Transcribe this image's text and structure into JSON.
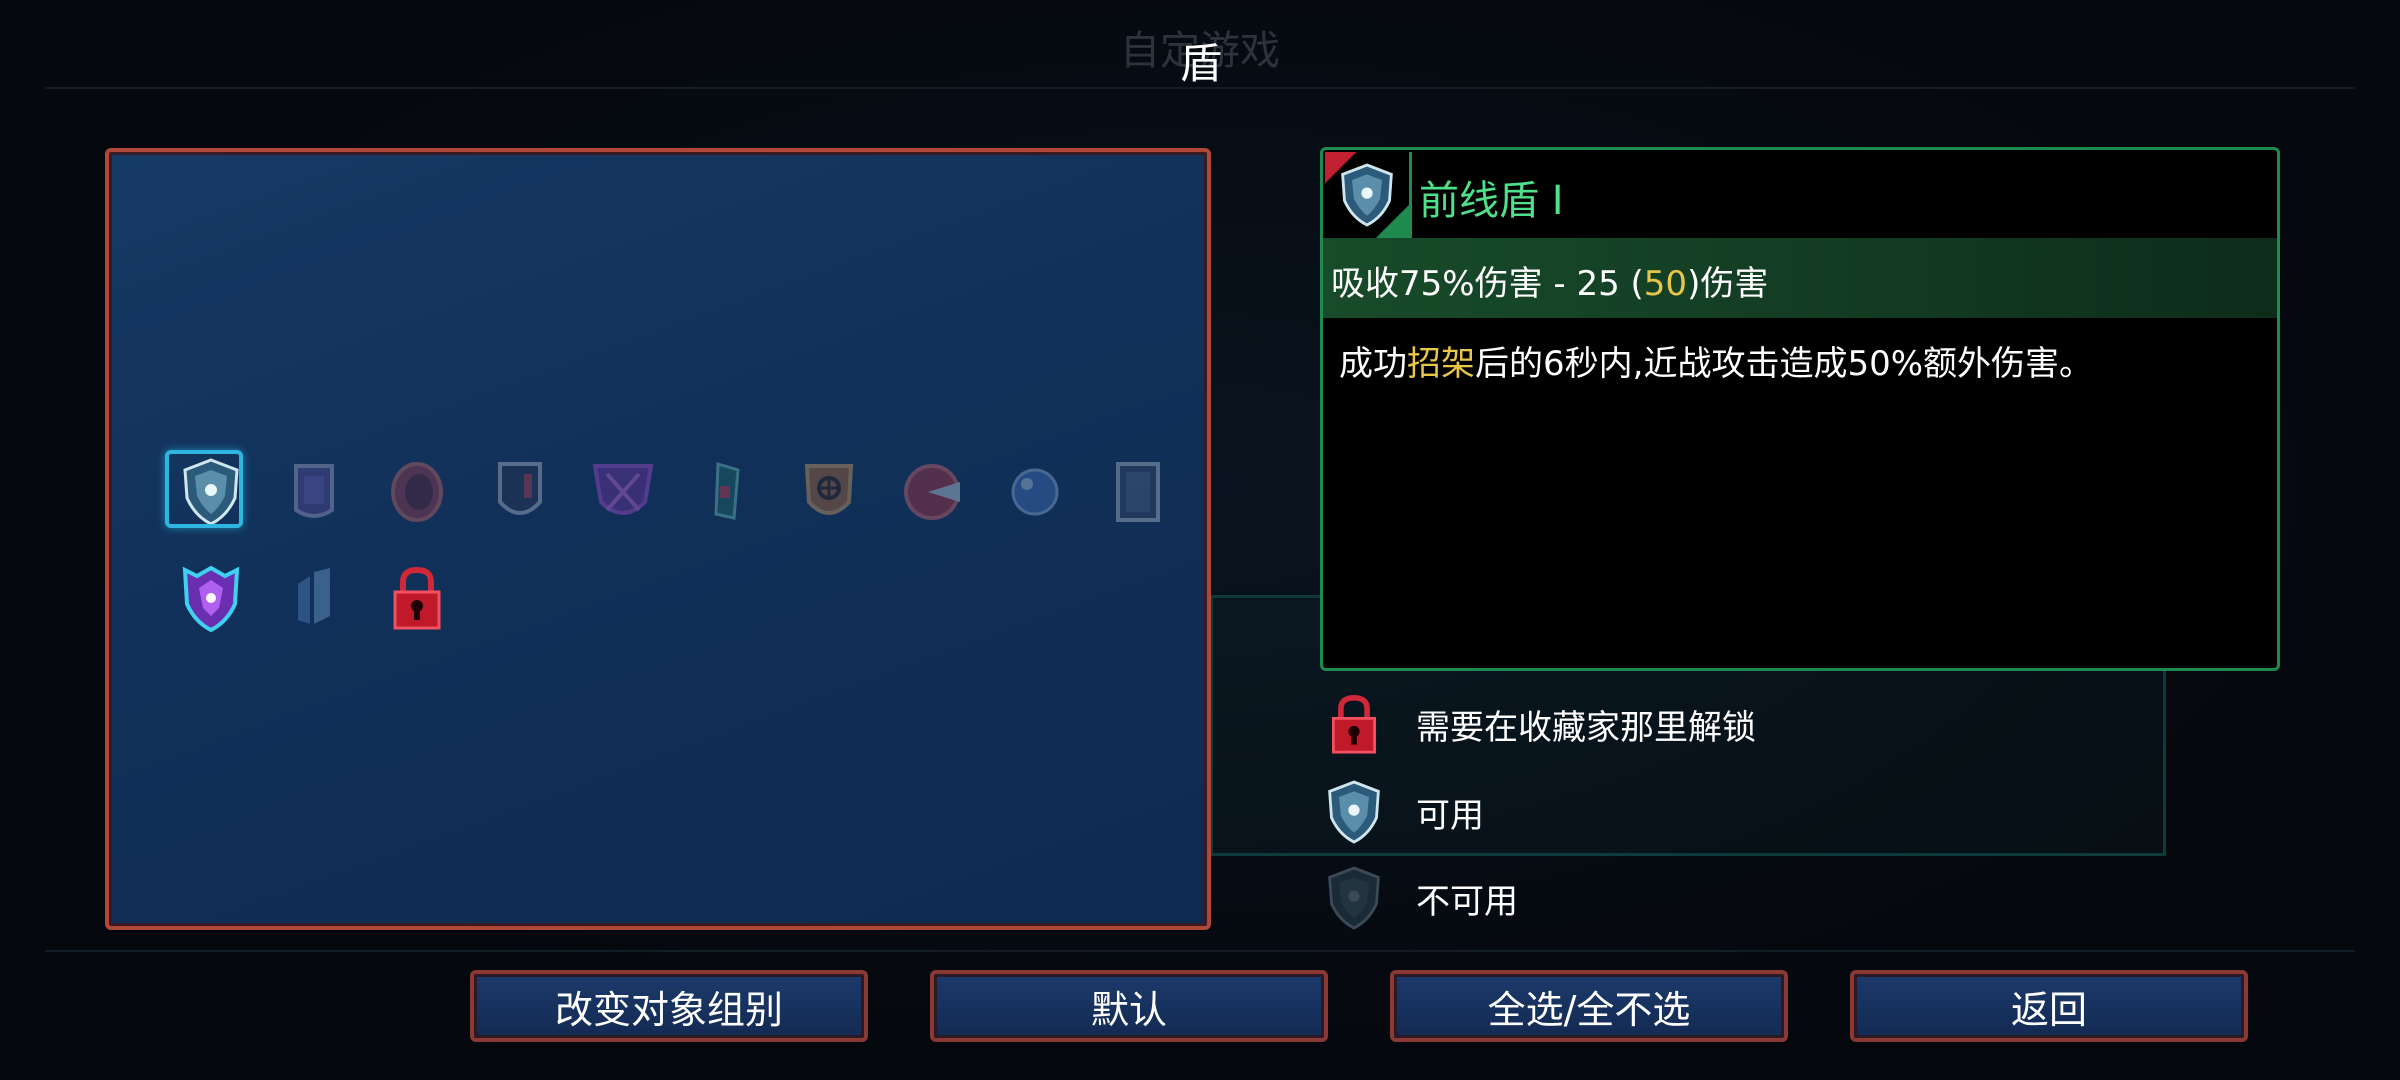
{
  "background_title": "自定游戏",
  "page_title": "盾",
  "detail": {
    "name": "前线盾 Ⅰ",
    "stat_prefix": "吸收75%伤害 - 25 (",
    "stat_highlight": "50",
    "stat_suffix": ")伤害",
    "desc_prefix": "成功",
    "desc_highlight": "招架",
    "desc_suffix": "后的6秒内,近战攻击造成50%额外伤害。"
  },
  "legend": {
    "locked": "需要在收藏家那里解锁",
    "available": "可用",
    "unavailable": "不可用"
  },
  "buttons": {
    "change_group": "改变对象组别",
    "default": "默认",
    "select_all": "全选/全不选",
    "back": "返回"
  },
  "grid_items": {
    "row1": [
      "front-line-shield",
      "purple-shield",
      "round-shield",
      "tower-shield",
      "spiked-purple-shield",
      "teal-shard-shield",
      "bronze-shield",
      "parry-shield",
      "orb-shield",
      "wall-shield"
    ],
    "row2": [
      "glowing-purple-shield",
      "crystal-shield",
      "locked-slot"
    ]
  },
  "colors": {
    "accent_green": "#4fe08a",
    "gold": "#e8c64a",
    "selection": "#2fb6e0",
    "frame_red": "#b0483a"
  }
}
